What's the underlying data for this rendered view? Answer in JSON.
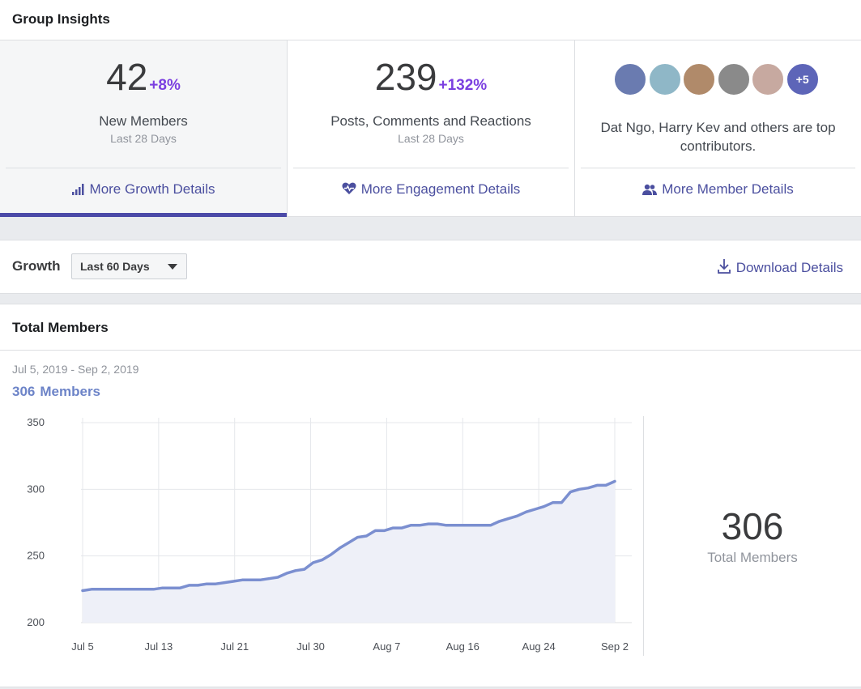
{
  "header": {
    "title": "Group Insights"
  },
  "stats": [
    {
      "value": "42",
      "change": "+8%",
      "label": "New Members",
      "sub": "Last 28 Days",
      "link": "More Growth Details"
    },
    {
      "value": "239",
      "change": "+132%",
      "label": "Posts, Comments and Reactions",
      "sub": "Last 28 Days",
      "link": "More Engagement Details"
    }
  ],
  "contributors": {
    "more_count": "+5",
    "text": "Dat Ngo, Harry Kev and others are top contributors.",
    "link": "More Member Details",
    "avatar_colors": [
      "#6a7bb0",
      "#8fb7c7",
      "#b08a6a",
      "#8a8a8a",
      "#c7a9a0"
    ]
  },
  "growth": {
    "title": "Growth",
    "period": "Last 60 Days",
    "download": "Download Details"
  },
  "members": {
    "title": "Total Members",
    "range": "Jul 5, 2019 - Sep 2, 2019",
    "count_value": "306",
    "count_label": "Members",
    "big_value": "306",
    "big_label": "Total Members"
  },
  "colors": {
    "accent": "#4b4f9f",
    "purple": "#7b3fe0",
    "line": "#7b8fd0",
    "fill": "#eef0f8"
  },
  "chart_data": {
    "type": "area",
    "x_tick_labels": [
      "Jul 5",
      "Jul 13",
      "Jul 21",
      "Jul 30",
      "Aug 7",
      "Aug 16",
      "Aug 24",
      "Sep 2"
    ],
    "y_tick_labels": [
      "350",
      "300",
      "250",
      "200"
    ],
    "ylim": [
      200,
      350
    ],
    "grid": true,
    "series": [
      {
        "values": [
          224,
          225,
          225,
          225,
          225,
          225,
          225,
          225,
          225,
          226,
          226,
          226,
          228,
          228,
          229,
          229,
          230,
          231,
          232,
          232,
          232,
          233,
          234,
          237,
          239,
          240,
          245,
          247,
          251,
          256,
          260,
          264,
          265,
          269,
          269,
          271,
          271,
          273,
          273,
          274,
          274,
          273,
          273,
          273,
          273,
          273,
          273,
          276,
          278,
          280,
          283,
          285,
          287,
          290,
          290,
          298,
          300,
          301,
          303,
          303,
          306
        ]
      }
    ]
  }
}
